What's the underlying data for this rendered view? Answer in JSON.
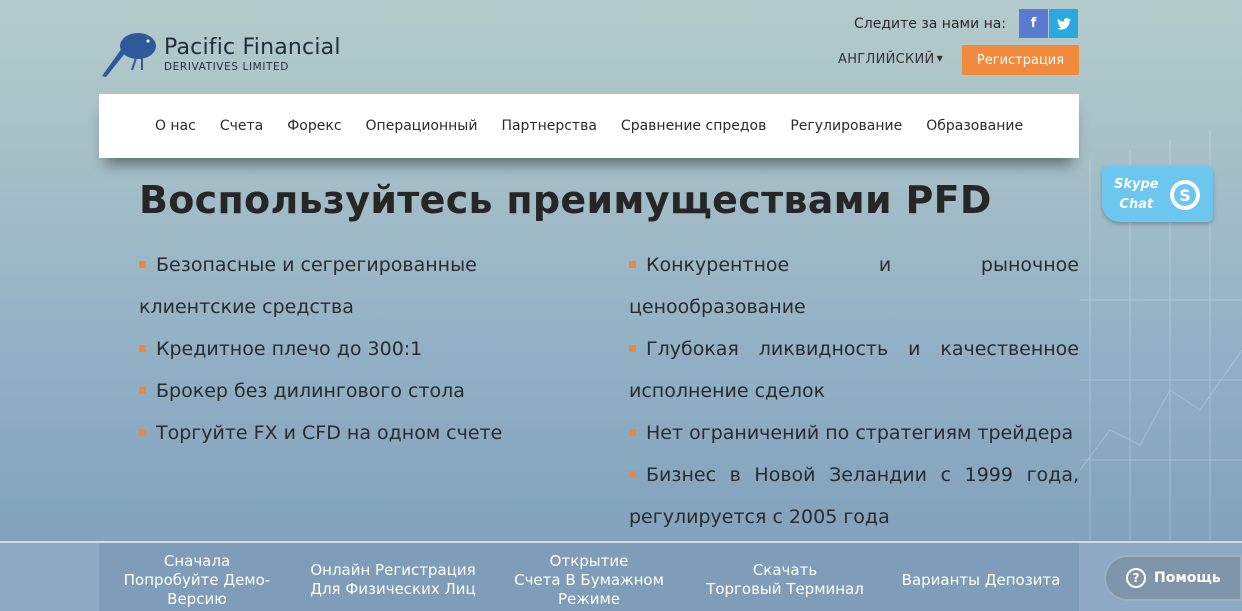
{
  "header": {
    "logo_title": "Pacific Financial",
    "logo_subtitle": "DERIVATIVES LIMITED",
    "follow_text": "Следите за нами на:",
    "social": {
      "facebook": "f",
      "twitter": "t"
    },
    "language": "АНГЛИЙСКИЙ",
    "register_label": "Регистрация"
  },
  "nav": {
    "items": [
      "О нас",
      "Счета",
      "Форекс",
      "Операционный",
      "Партнерства",
      "Сравнение спредов",
      "Регулирование",
      "Образование"
    ]
  },
  "skype": {
    "line1": "Skype",
    "line2": "Chat"
  },
  "main": {
    "heading": "Воспользуйтесь преимуществами PFD",
    "left_items": [
      "Безопасные и сегрегированные клиентские средства",
      "Кредитное плечо до 300:1",
      "Брокер без дилингового стола",
      "Торгуйте FX и CFD на одном счете"
    ],
    "right_items": [
      "Конкурентное и рыночное ценообразование",
      "Глубокая ликвидность и качественное исполнение сделок",
      "Нет ограничений по стратегиям трейдера",
      "Бизнес в Новой Зеландии с 1999 года, регулируется с 2005 года"
    ]
  },
  "bottom": {
    "items": [
      [
        "Сначала",
        "Попробуйте Демо-",
        "Версию"
      ],
      [
        "Онлайн Регистрация",
        "Для Физических Лиц"
      ],
      [
        "Открытие",
        "Счета В Бумажном",
        "Режиме"
      ],
      [
        "Скачать",
        "Торговый Терминал"
      ],
      [
        "Варианты Депозита"
      ]
    ]
  },
  "help": {
    "label": "Помощь"
  },
  "colors": {
    "accent": "#f28a3d",
    "skype": "#6cc6ee",
    "facebook": "#5b7bd0",
    "twitter": "#2aa9e0"
  }
}
